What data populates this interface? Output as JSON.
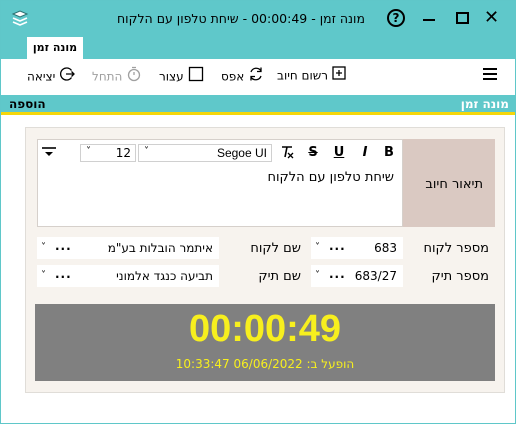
{
  "window": {
    "title": "מונה זמן - 00:00:49 - שיחת טלפון עם הלקוח",
    "icons": [
      "app-icon",
      "help-icon",
      "minimize-icon",
      "maximize-icon",
      "close-icon"
    ]
  },
  "ribbon": {
    "tab_label": "מונה זמן"
  },
  "toolbar": {
    "record_charge": "רשום חיוב",
    "reset": "אפס",
    "stop": "עצור",
    "start": "התחל",
    "exit": "יציאה"
  },
  "section": {
    "title": "מונה זמן",
    "add_label": "הוספה"
  },
  "description": {
    "label": "תיאור חיוב",
    "text": "שיחת טלפון עם הלקוח",
    "font_name": "Segoe UI",
    "font_size": "12",
    "format_bold": "B",
    "format_italic": "I",
    "format_underline": "U",
    "format_strike": "S"
  },
  "fields": {
    "client_number_label": "מספר לקוח",
    "client_number_value": "683",
    "client_name_label": "שם לקוח",
    "client_name_value": "איתמר הובלות בע\"מ",
    "case_number_label": "מספר תיק",
    "case_number_value": "683/27",
    "case_name_label": "שם תיק",
    "case_name_value": "תביעה כנגד אלמוני",
    "more": "...",
    "chevron": "˅"
  },
  "timer": {
    "elapsed": "00:00:49",
    "started": "הופעל ב: 06/06/2022 10:33:47"
  },
  "colors": {
    "accent": "#5fc8ca",
    "highlight_line": "#f5d60a",
    "timer_bg": "#808080",
    "timer_text": "#f7ef1e",
    "label_box": "#dac9c2",
    "panel_bg": "#f7f3ee"
  }
}
